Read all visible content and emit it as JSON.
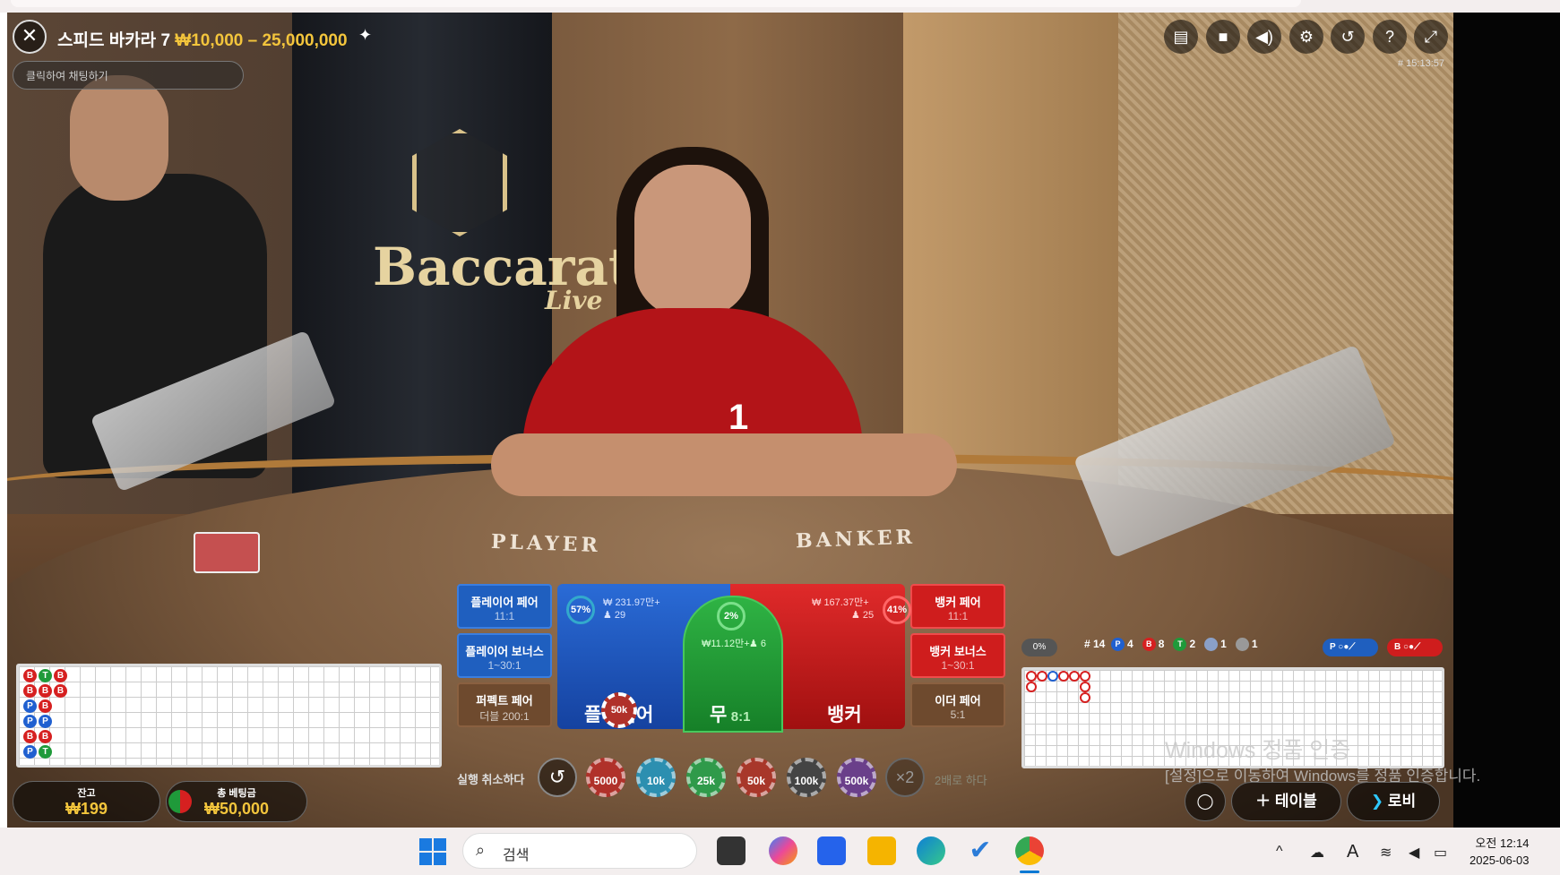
{
  "header": {
    "game_name": "스피드 바카라 7",
    "limits": "₩10,000 – 25,000,000",
    "chat_placeholder": "클릭하여 채팅하기",
    "timecode": "# 15:13:57",
    "tools": [
      "chat-icon",
      "video-icon",
      "volume-icon",
      "settings-icon",
      "history-icon",
      "help-icon",
      "fullscreen-icon"
    ]
  },
  "scene": {
    "logo_text": "Baccarat",
    "logo_sub": "Live",
    "felt_player": "PLAYER",
    "felt_banker": "BANKER",
    "countdown": "1"
  },
  "bets": {
    "player_pair": {
      "label": "플레이어 페어",
      "odds": "11:1"
    },
    "player_bonus": {
      "label": "플레이어 보너스",
      "odds": "1~30:1"
    },
    "perfect_pair": {
      "label": "퍼펙트 페어",
      "odds": "더블 200:1"
    },
    "banker_pair": {
      "label": "뱅커 페어",
      "odds": "11:1"
    },
    "banker_bonus": {
      "label": "뱅커 보너스",
      "odds": "1~30:1"
    },
    "either_pair": {
      "label": "이더 페어",
      "odds": "5:1"
    },
    "player": {
      "label": "플레이어",
      "percent": "57%",
      "amount": "₩ 231.97만+",
      "players": "29"
    },
    "banker": {
      "label": "뱅커",
      "percent": "41%",
      "amount": "₩ 167.37만+",
      "players": "25"
    },
    "tie": {
      "label": "무",
      "odds": "8:1",
      "percent": "2%",
      "amount": "₩11.12만+",
      "players": "6"
    },
    "placed_chip": "50k"
  },
  "chips": {
    "cancel_label": "실행 취소하다",
    "values": [
      "5000",
      "10k",
      "25k",
      "50k",
      "100k",
      "500k"
    ],
    "colors": [
      "#b0312a",
      "#2c8fb0",
      "#2f9a4a",
      "#a8372a",
      "#444444",
      "#6a3f8a"
    ],
    "double_symbol": "×2",
    "double_label": "2배로 하다"
  },
  "bead_road": [
    [
      "B",
      "T",
      "B"
    ],
    [
      "B",
      "B",
      "B"
    ],
    [
      "P",
      "B",
      ""
    ],
    [
      "P",
      "P",
      ""
    ],
    [
      "B",
      "B",
      ""
    ],
    [
      "P",
      "T",
      ""
    ]
  ],
  "balance": {
    "label": "잔고",
    "value": "₩199"
  },
  "total_bet": {
    "label": "총 베팅금",
    "value": "₩50,000"
  },
  "stats": {
    "progress": "0%",
    "round": "# 14",
    "player_wins": "4",
    "banker_wins": "8",
    "ties": "2",
    "player_pairs": "1",
    "banker_pairs": "1",
    "predict_player": "P",
    "predict_banker": "B"
  },
  "bottom_buttons": {
    "table_label": "테이블",
    "lobby_label": "로비"
  },
  "watermark": {
    "line1": "Windows 정품 인증",
    "line2": "[설정]으로 이동하여 Windows를 정품 인증합니다."
  },
  "taskbar": {
    "search_placeholder": "검색",
    "time": "오전 12:14",
    "date": "2025-06-03",
    "ime": "A"
  },
  "colors": {
    "accent_gold": "#f3c53c",
    "player_blue": "#1f5fbf",
    "banker_red": "#cf1d1d",
    "tie_green": "#2fb344"
  }
}
